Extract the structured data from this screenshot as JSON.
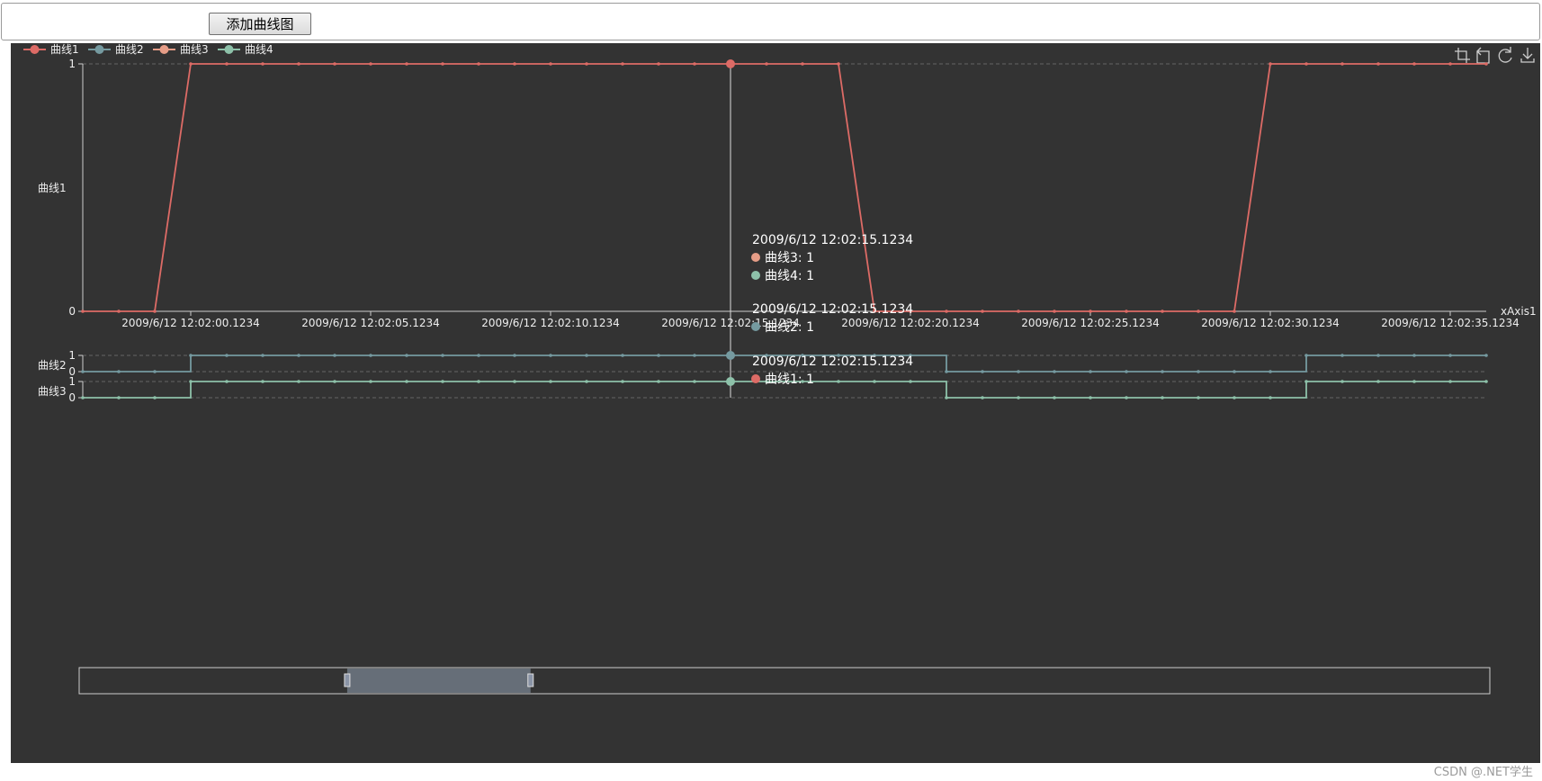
{
  "toolbar": {
    "add_button_label": "添加曲线图"
  },
  "toolbox_icons": [
    "zoom-select-icon",
    "zoom-back-icon",
    "restore-icon",
    "save-image-icon"
  ],
  "legend": [
    {
      "name": "曲线1",
      "color": "#dd6b66"
    },
    {
      "name": "曲线2",
      "color": "#759aa0"
    },
    {
      "name": "曲线3",
      "color": "#e69d87"
    },
    {
      "name": "曲线4",
      "color": "#8dc1a9"
    }
  ],
  "chart_data": {
    "type": "line",
    "x_tick_labels": [
      "2009/6/12 12:02:00.1234",
      "2009/6/12 12:02:05.1234",
      "2009/6/12 12:02:10.1234",
      "2009/6/12 12:02:15.1234",
      "2009/6/12 12:02:20.1234",
      "2009/6/12 12:02:25.1234",
      "2009/6/12 12:02:30.1234",
      "2009/6/12 12:02:35.1234"
    ],
    "x_name": "xAxis1",
    "x_start": "2009/6/12 12:01:57.1234",
    "x_end": "2009/6/12 12:02:36.1234",
    "x_step": "1 s",
    "ylim": [
      0,
      1
    ],
    "yticks": [
      0,
      1
    ],
    "grid_dashed": true,
    "legend_position": "top-left",
    "series": [
      {
        "name": "曲线1",
        "panel": "曲线1",
        "step": false,
        "color": "#dd6b66",
        "values": [
          0,
          0,
          0,
          1,
          1,
          1,
          1,
          1,
          1,
          1,
          1,
          1,
          1,
          1,
          1,
          1,
          1,
          1,
          1,
          1,
          1,
          1,
          0,
          0,
          0,
          0,
          0,
          0,
          0,
          0,
          0,
          0,
          0,
          1,
          1,
          1,
          1,
          1,
          1,
          1
        ]
      },
      {
        "name": "曲线2",
        "panel": "曲线2",
        "step": true,
        "color": "#759aa0",
        "values": [
          0,
          0,
          0,
          1,
          1,
          1,
          1,
          1,
          1,
          1,
          1,
          1,
          1,
          1,
          1,
          1,
          1,
          1,
          1,
          1,
          1,
          1,
          1,
          1,
          0,
          0,
          0,
          0,
          0,
          0,
          0,
          0,
          0,
          0,
          1,
          1,
          1,
          1,
          1,
          1
        ]
      },
      {
        "name": "曲线3",
        "panel": "曲线3",
        "step": true,
        "color": "#8dc1a9",
        "values": [
          0,
          0,
          0,
          1,
          1,
          1,
          1,
          1,
          1,
          1,
          1,
          1,
          1,
          1,
          1,
          1,
          1,
          1,
          1,
          1,
          1,
          1,
          1,
          1,
          0,
          0,
          0,
          0,
          0,
          0,
          0,
          0,
          0,
          0,
          1,
          1,
          1,
          1,
          1,
          1
        ]
      }
    ],
    "panel_labels": [
      "曲线1",
      "曲线2",
      "曲线3"
    ],
    "axis_pointer": "2009/6/12 12:02:15.1234",
    "tooltips": [
      {
        "time": "2009/6/12 12:02:15.1234",
        "rows": [
          {
            "name": "曲线3",
            "value": "1",
            "color": "#e69d87"
          },
          {
            "name": "曲线4",
            "value": "1",
            "color": "#8dc1a9"
          }
        ]
      },
      {
        "time": "2009/6/12 12:02:15.1234",
        "rows": [
          {
            "name": "曲线2",
            "value": "1",
            "color": "#759aa0"
          }
        ]
      },
      {
        "time": "2009/6/12 12:02:15.1234",
        "rows": [
          {
            "name": "曲线1",
            "value": "1",
            "color": "#dd6b66"
          }
        ]
      }
    ],
    "datazoom": {
      "start": 0.19,
      "end": 0.32
    }
  },
  "watermark": "CSDN @.NET学生"
}
